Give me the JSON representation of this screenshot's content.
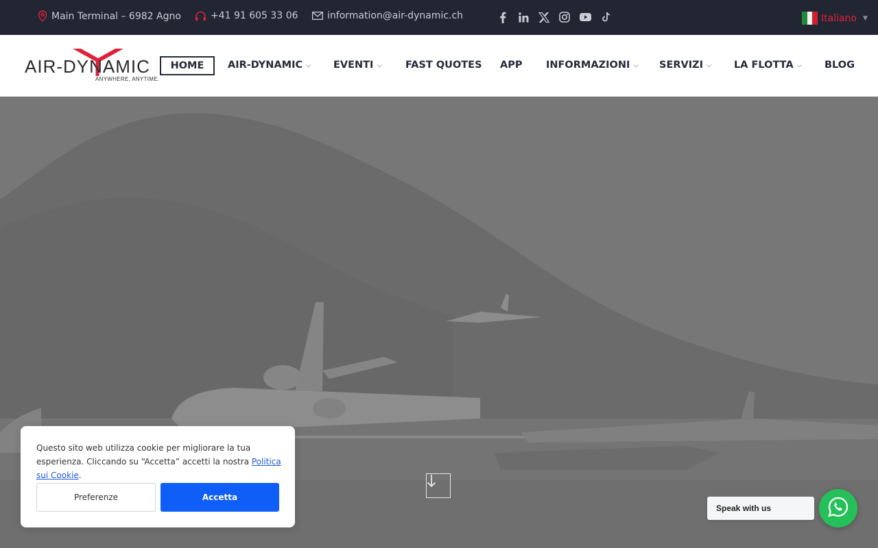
{
  "topbar": {
    "address": "Main Terminal – 6982 Agno",
    "phone": "+41 91 605 33 06",
    "email": "information@air-dynamic.ch",
    "socials": [
      "facebook-icon",
      "linkedin-icon",
      "x-icon",
      "instagram-icon",
      "youtube-icon",
      "tiktok-icon"
    ],
    "language": "Italiano",
    "accent_color": "#e0213a",
    "bg_color": "#222633"
  },
  "logo": {
    "name": "AIR-DYNAMIC",
    "tagline": "ANYWHERE, ANYTIME."
  },
  "nav": {
    "items": [
      {
        "label": "HOME",
        "dropdown": false,
        "active": true
      },
      {
        "label": "AIR-DYNAMIC",
        "dropdown": true
      },
      {
        "label": "EVENTI",
        "dropdown": true
      },
      {
        "label": "FAST QUOTES",
        "dropdown": false
      },
      {
        "label": "APP",
        "dropdown": false
      },
      {
        "label": "INFORMAZIONI",
        "dropdown": true
      },
      {
        "label": "SERVIZI",
        "dropdown": true
      },
      {
        "label": "LA FLOTTA",
        "dropdown": true
      },
      {
        "label": "BLOG",
        "dropdown": false
      }
    ]
  },
  "cookie": {
    "text_before": "Questo sito web utilizza cookie per migliorare la tua esperienza. Cliccando su “Accetta” accetti la nostra ",
    "link": "Politica sui Cookie",
    "text_after": ".",
    "preferences_label": "Preferenze",
    "accept_label": "Accetta",
    "accept_color": "#0f5ef7"
  },
  "whatsapp": {
    "label": "Speak with us",
    "color": "#25c05a"
  }
}
